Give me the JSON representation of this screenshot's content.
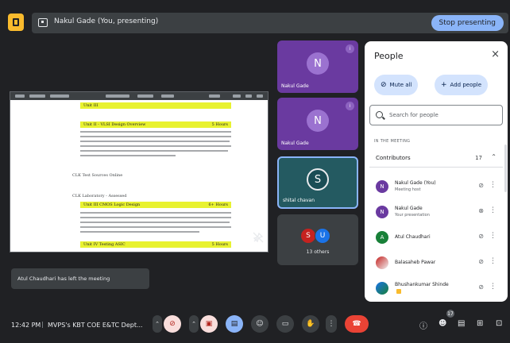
{
  "topbar": {
    "presenting_text": "Nakul Gade (You, presenting)",
    "stop_label": "Stop presenting"
  },
  "shared_doc": {
    "rows": [
      {
        "left": "Unit III",
        "right": ""
      },
      {
        "left": "Unit II - VLSI Design Overview",
        "right": "5 Hours"
      },
      {
        "left": "Unit III  CMOS Logic Design",
        "right": "6+ Hours"
      },
      {
        "left": "Unit IV  Testing ASIC",
        "right": "5 Hours"
      }
    ],
    "labels": {
      "blank": "CLK Test Sources Online",
      "section": "CLK Laboratory - Assessed"
    }
  },
  "tiles": [
    {
      "initial": "N",
      "name": "Nakul Gade"
    },
    {
      "initial": "N",
      "name": "Nakul Gade"
    },
    {
      "initial": "S",
      "name": "shital chavan"
    },
    {
      "initials": [
        "S",
        "U"
      ],
      "name": "13 others"
    }
  ],
  "panel": {
    "title": "People",
    "close": "×",
    "mute_all": "Mute all",
    "add_people": "Add people",
    "search_placeholder": "Search for people",
    "section": "IN THE MEETING",
    "group_label": "Contributors",
    "group_count": "17",
    "people": [
      {
        "initial": "N",
        "name": "Nakul Gade (You)",
        "sub": "Meeting host",
        "color": "#6a3aa0"
      },
      {
        "initial": "N",
        "name": "Nakul Gade",
        "sub": "Your presentation",
        "color": "#6a3aa0"
      },
      {
        "initial": "A",
        "name": "Atul Chaudhari",
        "sub": "",
        "color": "#188038"
      },
      {
        "initial": "",
        "name": "Balasaheb Pawar",
        "sub": "",
        "color": "#c5221f"
      },
      {
        "initial": "",
        "name": "Bhushankumar Shinde",
        "sub": "",
        "color": "#1a73e8"
      }
    ]
  },
  "toast": "Atul Chaudhari has left the meeting",
  "bottombar": {
    "time": "12:42 PM",
    "meeting": "MVPS's KBT COE E&TC Dept...",
    "people_count": "17"
  },
  "icons": {
    "mic_off": "mic-off-icon",
    "cam_off": "camera-off-icon",
    "present": "present-icon",
    "emoji": "emoji-icon",
    "captions": "captions-icon",
    "hand": "raise-hand-icon",
    "more": "more-vert-icon",
    "end": "call-end-icon",
    "info": "info-icon",
    "people": "people-icon",
    "chat": "chat-icon",
    "activities": "activities-icon",
    "lock": "lock-icon"
  },
  "colors": {
    "accent": "#8ab4f8",
    "background": "#202124",
    "tile_purple": "#6a3aa0",
    "end_call": "#ea4335",
    "highlight": "#e8f230"
  }
}
